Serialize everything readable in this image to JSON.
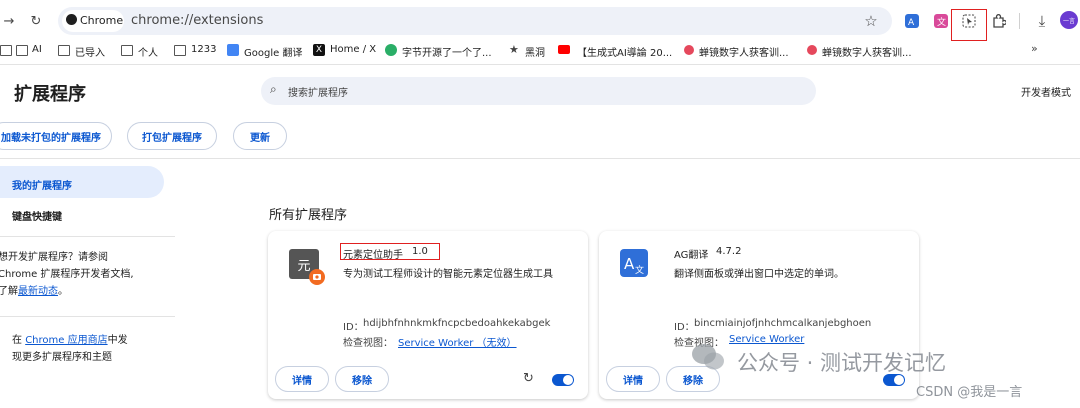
{
  "browser": {
    "chip_label": "Chrome",
    "url": "chrome://extensions",
    "profile_initial": "一言"
  },
  "bookmarks": [
    "AI",
    "已导入",
    "个人",
    "1233",
    "Google 翻译",
    "Home / X",
    "字节开源了一个了...",
    "黑洞",
    "【生成式AI導論 20...",
    "蝉镜数字人获客训...",
    "蝉镜数字人获客训..."
  ],
  "page": {
    "title": "扩展程序",
    "search_placeholder": "搜索扩展程序",
    "developer_mode_label": "开发者模式",
    "buttons": {
      "load_unpacked": "加载未打包的扩展程序",
      "pack": "打包扩展程序",
      "update": "更新"
    }
  },
  "sidebar": {
    "items": [
      {
        "label": "我的扩展程序",
        "active": true
      },
      {
        "label": "键盘快捷键",
        "active": false
      }
    ],
    "dev_text_1": "想开发扩展程序？请参阅",
    "dev_text_2": "Chrome 扩展程序开发者文档,",
    "dev_text_3": "了解",
    "dev_link": "最新动态",
    "dev_text_4": "。",
    "store_text_1": "在",
    "store_link": "Chrome 应用商店",
    "store_text_2": "中发",
    "store_text_3": "现更多扩展程序和主题"
  },
  "section_title": "所有扩展程序",
  "extensions": [
    {
      "icon_text": "元",
      "name": "元素定位助手",
      "version": "1.0",
      "description": "专为测试工程师设计的智能元素定位器生成工具",
      "id_label": "ID：",
      "id": "hdijbhfnhnkmkfncpcbedoahkekabgek",
      "views_label": "检查视图：",
      "view_link": "Service Worker （无效）",
      "details_label": "详情",
      "remove_label": "移除",
      "enabled": true
    },
    {
      "icon_text": "A",
      "name": "AG翻译",
      "version": "4.7.2",
      "description": "翻译侧面板或弹出窗口中选定的单词。",
      "id_label": "ID：",
      "id": "bincmiainjofjnhchmcalkanjebghoen",
      "views_label": "检查视图：",
      "view_link": "Service Worker",
      "details_label": "详情",
      "remove_label": "移除",
      "enabled": true
    }
  ],
  "watermark": {
    "line1": "公众号 · 测试开发记忆",
    "line2": "CSDN @我是一言"
  },
  "colors": {
    "accent": "#0b57d0",
    "highlight_box": "#e02020",
    "sidebar_active": "#e4edfd"
  }
}
